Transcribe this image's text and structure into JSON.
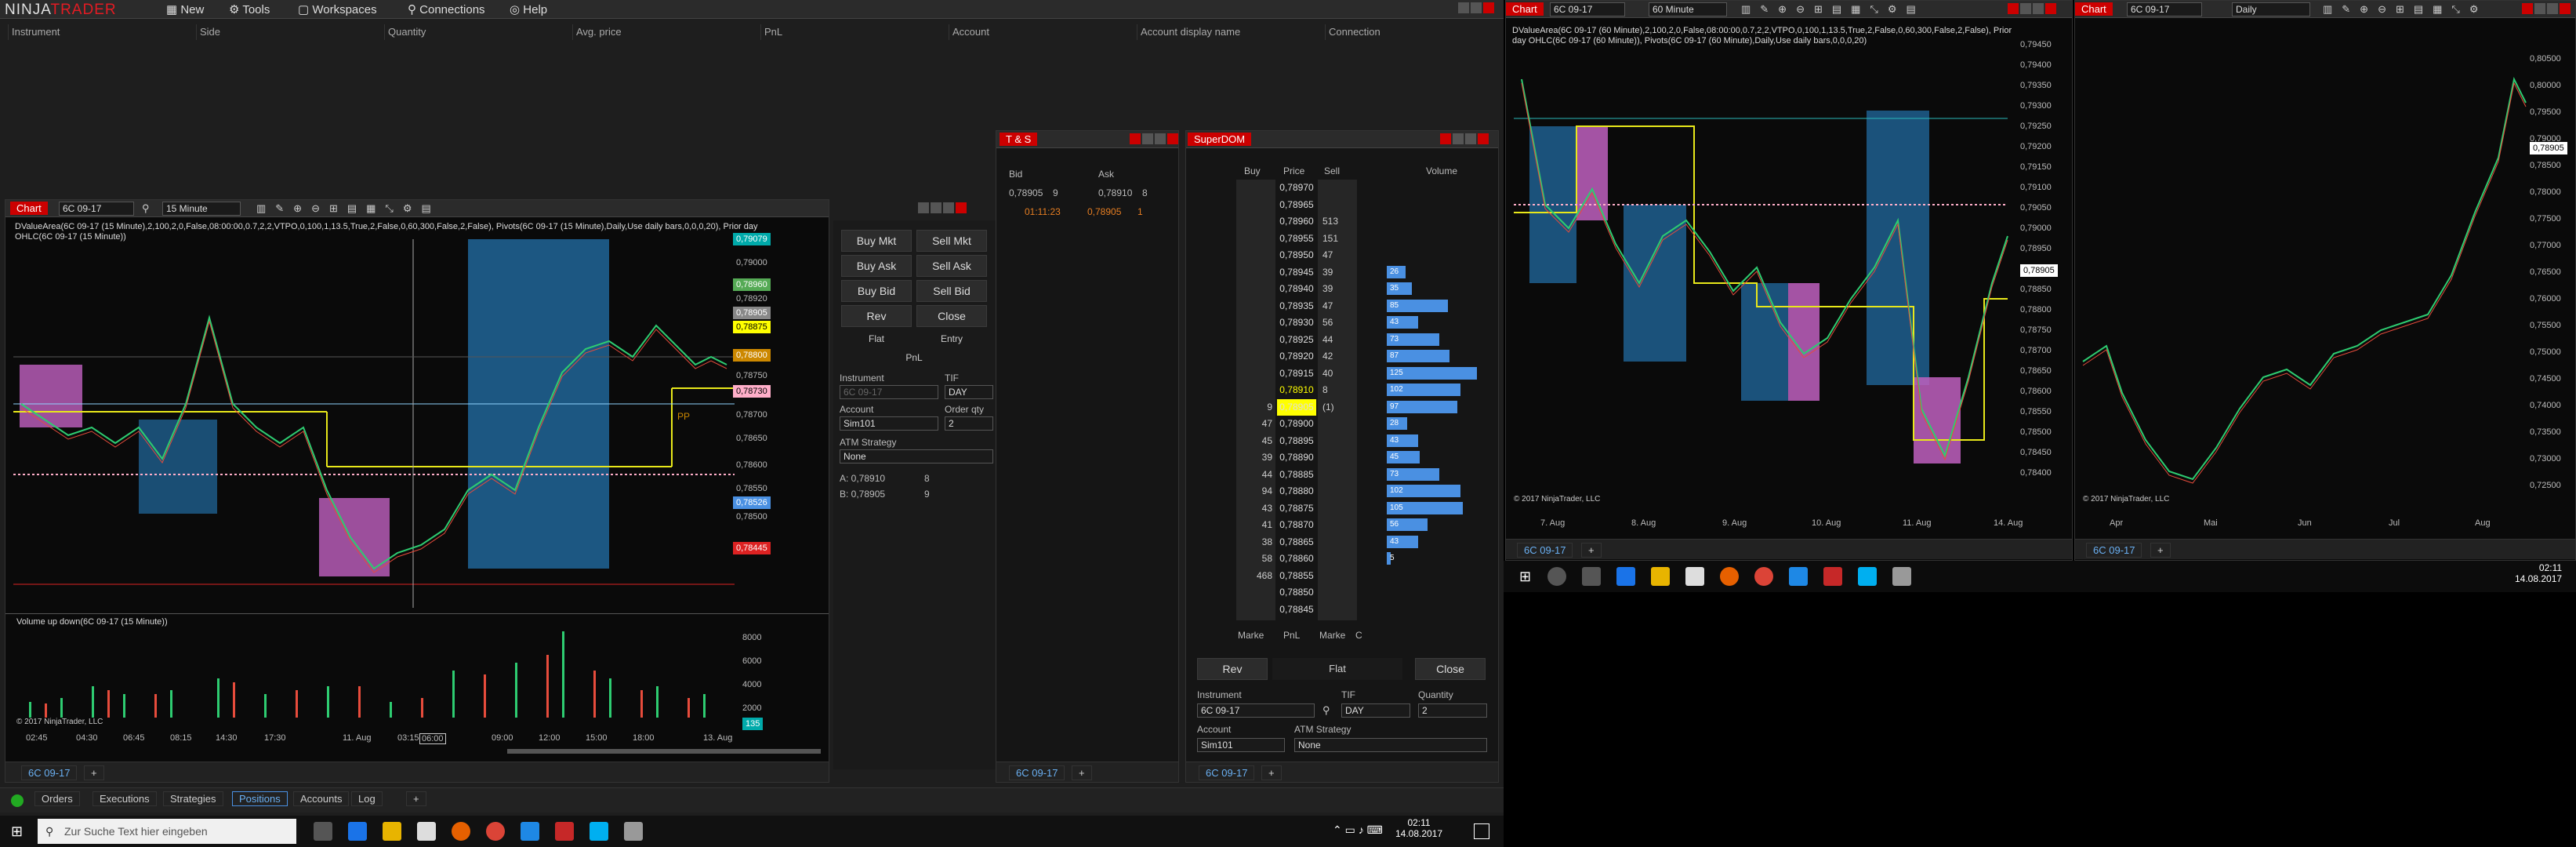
{
  "app": {
    "logo_ninja": "NINJA",
    "logo_trader": "TRADER"
  },
  "menubar": {
    "items": [
      "New",
      "Tools",
      "Workspaces",
      "Connections",
      "Help"
    ]
  },
  "positions": {
    "columns": [
      "Instrument",
      "Side",
      "Quantity",
      "Avg. price",
      "PnL",
      "Account",
      "Account display name",
      "Connection"
    ]
  },
  "bottom_tabs": [
    "Orders",
    "Executions",
    "Strategies",
    "Positions",
    "Accounts",
    "Log"
  ],
  "chart1": {
    "title": "Chart",
    "instrument": "6C 09-17",
    "interval": "15 Minute",
    "indicator_text": "DValueArea(6C 09-17 (15 Minute),2,100,2,0,False,08:00:00,0.7,2,2,VTPO,0,100,1,13.5,True,2,False,0,60,300,False,2,False), Pivots(6C 09-17 (15 Minute),Daily,Use daily bars,0,0,0,20), Prior day OHLC(6C 09-17 (15 Minute))",
    "price_labels": [
      {
        "v": "0,79079",
        "c": "#0aa"
      },
      {
        "v": "0,79000",
        "c": ""
      },
      {
        "v": "0,78960",
        "c": "#5a5"
      },
      {
        "v": "0,78920",
        "c": ""
      },
      {
        "v": "0,78905",
        "c": "#888"
      },
      {
        "v": "0,78875",
        "c": "#ff0"
      },
      {
        "v": "0,78800",
        "c": "#c80"
      },
      {
        "v": "0,78750",
        "c": ""
      },
      {
        "v": "0,78730",
        "c": "#ffaec9"
      },
      {
        "v": "0,78700",
        "c": ""
      },
      {
        "v": "0,78650",
        "c": ""
      },
      {
        "v": "0,78600",
        "c": ""
      },
      {
        "v": "0,78550",
        "c": ""
      },
      {
        "v": "0,78526",
        "c": "#4a90e2"
      },
      {
        "v": "0,78500",
        "c": ""
      },
      {
        "v": "0,78445",
        "c": "#d22"
      }
    ],
    "volume_label": "Volume up down(6C 09-17 (15 Minute))",
    "volume_axis": [
      "8000",
      "6000",
      "4000",
      "2000",
      "135"
    ],
    "time_axis": [
      "02:45",
      "04:30",
      "06:45",
      "08:15",
      "14:30",
      "17:30",
      "11. Aug",
      "03:15",
      "06:00",
      "09:00",
      "12:00",
      "15:00",
      "18:00",
      "13. Aug"
    ],
    "copyright": "© 2017 NinjaTrader, LLC",
    "tab": "6C 09-17",
    "pp_label": "PP"
  },
  "order_panel": {
    "buy_mkt": "Buy Mkt",
    "sell_mkt": "Sell Mkt",
    "buy_ask": "Buy Ask",
    "sell_ask": "Sell Ask",
    "buy_bid": "Buy Bid",
    "sell_bid": "Sell Bid",
    "rev": "Rev",
    "close": "Close",
    "flat": "Flat",
    "entry": "Entry",
    "pnl": "PnL",
    "instrument_lbl": "Instrument",
    "instrument": "6C 09-17",
    "tif_lbl": "TIF",
    "tif": "DAY",
    "account_lbl": "Account",
    "account": "Sim101",
    "qty_lbl": "Order qty",
    "qty": "2",
    "atm_lbl": "ATM Strategy",
    "atm": "None",
    "a_row": "A: 0,78910",
    "a_qty": "8",
    "b_row": "B: 0,78905",
    "b_qty": "9"
  },
  "ts": {
    "title": "T & S",
    "bid_lbl": "Bid",
    "ask_lbl": "Ask",
    "bid": "0,78905",
    "bid_qty": "9",
    "ask": "0,78910",
    "ask_qty": "8",
    "time": "01:11:23",
    "price": "0,78905",
    "qty": "1",
    "tab": "6C 09-17"
  },
  "dom": {
    "title": "SuperDOM",
    "headers": {
      "buy": "Buy",
      "price": "Price",
      "sell": "Sell",
      "volume": "Volume"
    },
    "rows": [
      {
        "buy": "",
        "price": "0,78970",
        "sell": "",
        "vol": ""
      },
      {
        "buy": "",
        "price": "0,78965",
        "sell": "",
        "vol": ""
      },
      {
        "buy": "",
        "price": "0,78960",
        "sell": "513",
        "vol": ""
      },
      {
        "buy": "",
        "price": "0,78955",
        "sell": "151",
        "vol": ""
      },
      {
        "buy": "",
        "price": "0,78950",
        "sell": "47",
        "vol": ""
      },
      {
        "buy": "",
        "price": "0,78945",
        "sell": "39",
        "vol": "26"
      },
      {
        "buy": "",
        "price": "0,78940",
        "sell": "39",
        "vol": "35"
      },
      {
        "buy": "",
        "price": "0,78935",
        "sell": "47",
        "vol": "85"
      },
      {
        "buy": "",
        "price": "0,78930",
        "sell": "56",
        "vol": "43"
      },
      {
        "buy": "",
        "price": "0,78925",
        "sell": "44",
        "vol": "73"
      },
      {
        "buy": "",
        "price": "0,78920",
        "sell": "42",
        "vol": "87"
      },
      {
        "buy": "",
        "price": "0,78915",
        "sell": "40",
        "vol": "125"
      },
      {
        "buy": "",
        "price": "0,78910",
        "sell": "8",
        "vol": "102"
      },
      {
        "buy": "9",
        "price": "0,78905",
        "sell": "(1)",
        "vol": "97"
      },
      {
        "buy": "47",
        "price": "0,78900",
        "sell": "",
        "vol": "28"
      },
      {
        "buy": "45",
        "price": "0,78895",
        "sell": "",
        "vol": "43"
      },
      {
        "buy": "39",
        "price": "0,78890",
        "sell": "",
        "vol": "45"
      },
      {
        "buy": "44",
        "price": "0,78885",
        "sell": "",
        "vol": "73"
      },
      {
        "buy": "94",
        "price": "0,78880",
        "sell": "",
        "vol": "102"
      },
      {
        "buy": "43",
        "price": "0,78875",
        "sell": "",
        "vol": "105"
      },
      {
        "buy": "41",
        "price": "0,78870",
        "sell": "",
        "vol": "56"
      },
      {
        "buy": "38",
        "price": "0,78865",
        "sell": "",
        "vol": "43"
      },
      {
        "buy": "58",
        "price": "0,78860",
        "sell": "",
        "vol": "5"
      },
      {
        "buy": "468",
        "price": "0,78855",
        "sell": "",
        "vol": ""
      },
      {
        "buy": "",
        "price": "0,78850",
        "sell": "",
        "vol": ""
      },
      {
        "buy": "",
        "price": "0,78845",
        "sell": "",
        "vol": ""
      }
    ],
    "footer": {
      "market_buy": "Marke",
      "pnl": "PnL",
      "market_sell": "Marke",
      "c": "C"
    },
    "rev": "Rev",
    "flat": "Flat",
    "close": "Close",
    "instrument_lbl": "Instrument",
    "instrument": "6C 09-17",
    "tif_lbl": "TIF",
    "tif": "DAY",
    "qty_lbl": "Quantity",
    "qty": "2",
    "account_lbl": "Account",
    "account": "Sim101",
    "atm_lbl": "ATM Strategy",
    "atm": "None",
    "tab": "6C 09-17"
  },
  "chart2": {
    "title": "Chart",
    "instrument": "6C 09-17",
    "interval": "60 Minute",
    "indicator_text": "DValueArea(6C 09-17 (60 Minute),2,100,2,0,False,08:00:00,0.7,2,2,VTPO,0,100,1,13.5,True,2,False,0,60,300,False,2,False), Prior day OHLC(6C 09-17 (60 Minute)), Pivots(6C 09-17 (60 Minute),Daily,Use daily bars,0,0,0,20)",
    "price_axis": [
      "0,79450",
      "0,79400",
      "0,79350",
      "0,79300",
      "0,79250",
      "0,79200",
      "0,79150",
      "0,79100",
      "0,79050",
      "0,79000",
      "0,78950",
      "0,78905",
      "0,78850",
      "0,78800",
      "0,78750",
      "0,78700",
      "0,78650",
      "0,78600",
      "0,78550",
      "0,78500",
      "0,78450",
      "0,78400"
    ],
    "time_axis": [
      "7. Aug",
      "8. Aug",
      "9. Aug",
      "10. Aug",
      "11. Aug",
      "14. Aug"
    ],
    "copyright": "© 2017 NinjaTrader, LLC",
    "tab": "6C 09-17"
  },
  "chart3": {
    "title": "Chart",
    "instrument": "6C 09-17",
    "interval": "Daily",
    "price_axis": [
      "0,80500",
      "0,80000",
      "0,79500",
      "0,79000",
      "0,78905",
      "0,78500",
      "0,78000",
      "0,77500",
      "0,77000",
      "0,76500",
      "0,76000",
      "0,75500",
      "0,75000",
      "0,74500",
      "0,74000",
      "0,73500",
      "0,73000",
      "0,72500"
    ],
    "time_axis": [
      "Apr",
      "Mai",
      "Jun",
      "Jul",
      "Aug"
    ],
    "copyright": "© 2017 NinjaTrader, LLC",
    "tab": "6C 09-17"
  },
  "taskbar": {
    "search_placeholder": "Zur Suche Text hier eingeben",
    "time": "02:11",
    "date": "14.08.2017"
  },
  "taskbar2": {
    "time": "02:11",
    "date": "14.08.2017"
  }
}
